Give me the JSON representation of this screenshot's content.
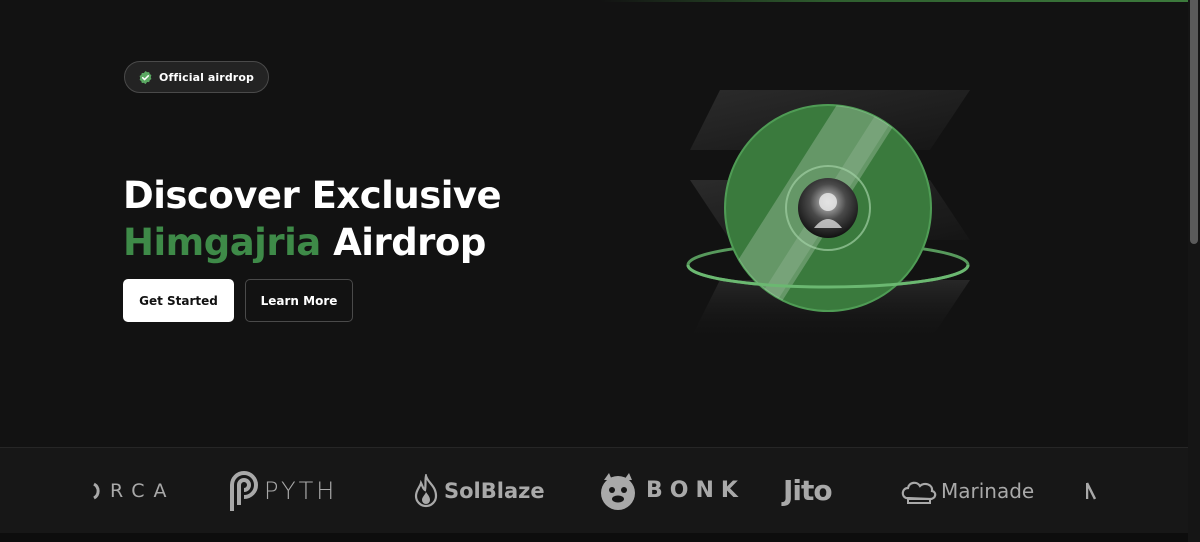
{
  "badge": {
    "label": "Official airdrop",
    "icon": "verified-check-icon",
    "color": "#5aa862"
  },
  "hero": {
    "title_line1": "Discover Exclusive",
    "title_accent": "Himgajria",
    "title_rest": " Airdrop",
    "accent_color": "#3e8a48",
    "primary_button": "Get Started",
    "secondary_button": "Learn More"
  },
  "partners": [
    {
      "name": "ORCA",
      "text": "RCA",
      "icon": "orca-logo-icon"
    },
    {
      "name": "PYTH",
      "text": "PYTH",
      "icon": "pyth-logo-icon"
    },
    {
      "name": "SolBlaze",
      "text": "SolBlaze",
      "icon": "flame-icon"
    },
    {
      "name": "BONK",
      "text": "BONK",
      "icon": "bonk-dog-icon"
    },
    {
      "name": "Jito",
      "text": "Jito",
      "icon": "jito-logo-icon"
    },
    {
      "name": "Marinade",
      "text": "Marinade",
      "icon": "chef-hat-icon"
    }
  ],
  "colors": {
    "background": "#121212",
    "coin_green": "#3d7f3f",
    "logo_gray": "#a9a9a9"
  }
}
